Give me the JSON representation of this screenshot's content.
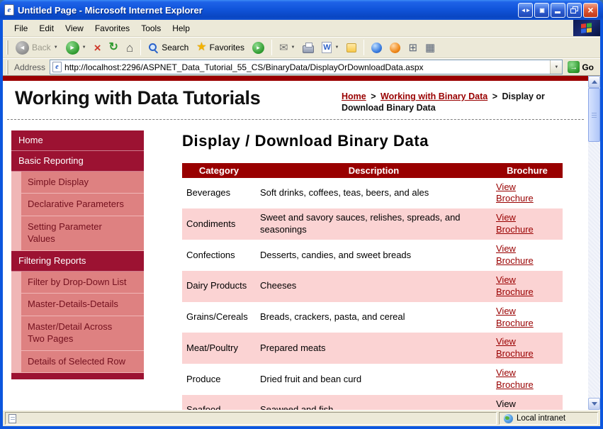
{
  "window": {
    "title": "Untitled Page - Microsoft Internet Explorer"
  },
  "menu": {
    "items": [
      "File",
      "Edit",
      "View",
      "Favorites",
      "Tools",
      "Help"
    ]
  },
  "toolbar": {
    "back": "Back",
    "search": "Search",
    "favorites": "Favorites"
  },
  "address": {
    "label": "Address",
    "url": "http://localhost:2296/ASPNET_Data_Tutorial_55_CS/BinaryData/DisplayOrDownloadData.aspx",
    "go": "Go"
  },
  "header": {
    "site_title": "Working with Data Tutorials",
    "breadcrumb": {
      "home": "Home",
      "sep": ">",
      "section": "Working with Binary Data",
      "current": "Display or Download Binary Data"
    }
  },
  "content": {
    "heading": "Display / Download Binary Data"
  },
  "sidebar": {
    "items": [
      {
        "label": "Home",
        "type": "section"
      },
      {
        "label": "Basic Reporting",
        "type": "section"
      },
      {
        "label": "Simple Display",
        "type": "sub"
      },
      {
        "label": "Declarative Parameters",
        "type": "sub"
      },
      {
        "label": "Setting Parameter Values",
        "type": "sub"
      },
      {
        "label": "Filtering Reports",
        "type": "section"
      },
      {
        "label": "Filter by Drop-Down List",
        "type": "sub"
      },
      {
        "label": "Master-Details-Details",
        "type": "sub"
      },
      {
        "label": "Master/Detail Across Two Pages",
        "type": "sub"
      },
      {
        "label": "Details of Selected Row",
        "type": "sub"
      }
    ]
  },
  "table": {
    "headers": [
      "Category",
      "Description",
      "Brochure"
    ],
    "rows": [
      {
        "category": "Beverages",
        "description": "Soft drinks, coffees, teas, beers, and ales",
        "brochure": "View Brochure",
        "link": true
      },
      {
        "category": "Condiments",
        "description": "Sweet and savory sauces, relishes, spreads, and seasonings",
        "brochure": "View Brochure",
        "link": true
      },
      {
        "category": "Confections",
        "description": "Desserts, candies, and sweet breads",
        "brochure": "View Brochure",
        "link": true
      },
      {
        "category": "Dairy Products",
        "description": "Cheeses",
        "brochure": "View Brochure",
        "link": true
      },
      {
        "category": "Grains/Cereals",
        "description": "Breads, crackers, pasta, and cereal",
        "brochure": "View Brochure",
        "link": true
      },
      {
        "category": "Meat/Poultry",
        "description": "Prepared meats",
        "brochure": "View Brochure",
        "link": true
      },
      {
        "category": "Produce",
        "description": "Dried fruit and bean curd",
        "brochure": "View Brochure",
        "link": true
      },
      {
        "category": "Seafood",
        "description": "Seaweed and fish",
        "brochure": "View Brochure",
        "link": false
      }
    ]
  },
  "status": {
    "zone": "Local intranet"
  },
  "icons": {
    "ie_e": "e",
    "close": "×",
    "title_arrows": "◄►",
    "title_window": "▣",
    "back_arrow": "◄",
    "forward_arrow": "►",
    "dropdown": "▼",
    "stop": "×",
    "refresh": "↻",
    "home": "⌂",
    "favorites_star": "★",
    "media_play": "▸",
    "mail": "✉",
    "word": "W",
    "panel": "⊞",
    "grid": "▦",
    "go_arrow": "→"
  },
  "colors": {
    "titlebar_blue": "#1155DB",
    "chrome_beige": "#ECE9D8",
    "maroon": "#990000",
    "nav_section_bg": "#9C1232",
    "nav_sub_bg": "#DE8181",
    "nav_sub_stripe": "#F0B6B6",
    "row_pink": "#FBD3D3",
    "link_maroon": "#990000"
  }
}
